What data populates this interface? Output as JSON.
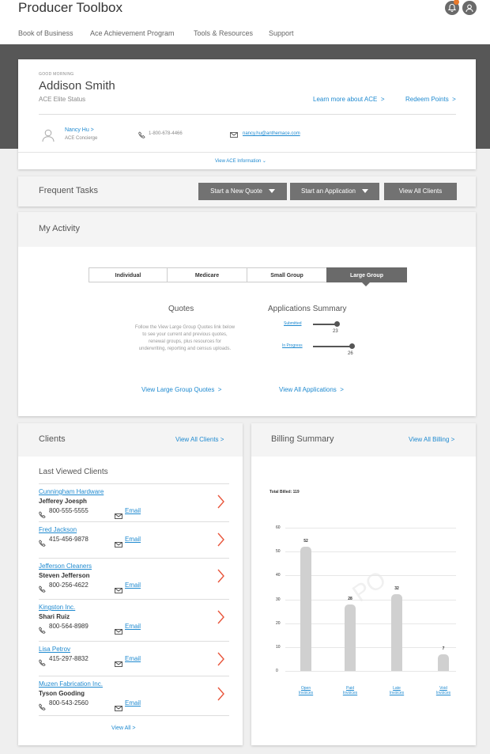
{
  "app": {
    "title": "Producer Toolbox"
  },
  "nav": [
    "Book of Business",
    "Ace Achievement Program",
    "Tools & Resources",
    "Support"
  ],
  "greeting": {
    "salutation": "GOOD MORNING",
    "name": "Addison Smith",
    "status": "ACE Elite Status",
    "learn_more": "Learn more about ACE",
    "redeem": "Redeem Points"
  },
  "concierge": {
    "name": "Nancy Hu",
    "role": "ACE Concierge",
    "phone": "1-800-678-4466",
    "email": "nancy.hu@anthemace.com",
    "view_info": "View ACE Information"
  },
  "tasks": {
    "title": "Frequent Tasks",
    "buttons": [
      "Start a New Quote",
      "Start an Application",
      "View All Clients"
    ]
  },
  "activity": {
    "title": "My Activity",
    "tabs": [
      "Individual",
      "Medicare",
      "Small Group",
      "Large Group"
    ],
    "active_tab": "Large Group",
    "quotes_title": "Quotes",
    "quotes_text": "Follow the View Large Group Quotes link below to see your current and previous quotes, renewal groups, plus resources for underwriting, reporting and census uploads.",
    "quotes_link": "View Large Group Quotes",
    "apps_title": "Applications Summary",
    "apps": [
      {
        "label": "Submitted",
        "count": "23"
      },
      {
        "label": "In Progress",
        "count": "26"
      }
    ],
    "apps_link": "View All Applications"
  },
  "clients": {
    "title": "Clients",
    "view_all_header": "View All Clients",
    "subtitle": "Last Viewed Clients",
    "email_label": "Email",
    "list": [
      {
        "company": "Cunningham Hardware",
        "contact": "Jefferey Joesph",
        "phone": "800-555-5555"
      },
      {
        "company": "Fred Jackson",
        "contact": "",
        "phone": "415-456-9878"
      },
      {
        "company": "Jefferson Cleaners",
        "contact": "Steven Jefferson",
        "phone": "800-256-4622"
      },
      {
        "company": "Kingston Inc.",
        "contact": "Shari Ruiz",
        "phone": "800-564-8989"
      },
      {
        "company": "Lisa Petrov",
        "contact": "",
        "phone": "415-297-8832"
      },
      {
        "company": "Muzen Fabrication Inc.",
        "contact": "Tyson Gooding",
        "phone": "800-543-2560"
      }
    ],
    "view_all_footer": "View All"
  },
  "billing": {
    "title": "Billing Summary",
    "view_all": "View All Billing",
    "total_billed": "Total Billed: 119",
    "watermark": "PO"
  },
  "chart_data": {
    "type": "bar",
    "categories": [
      "Open Invoices",
      "Paid Invoices",
      "Late Invoices",
      "Void Invoices"
    ],
    "values": [
      52,
      28,
      32,
      7
    ],
    "ylim": [
      0,
      60
    ],
    "yticks": [
      0,
      10,
      20,
      30,
      40,
      50,
      60
    ],
    "grid": true,
    "bar_color": "#d0d0d0"
  },
  "colors": {
    "accent": "#1f8ad0",
    "chevron": "#e8553b",
    "band": "#575757",
    "button": "#727272"
  }
}
